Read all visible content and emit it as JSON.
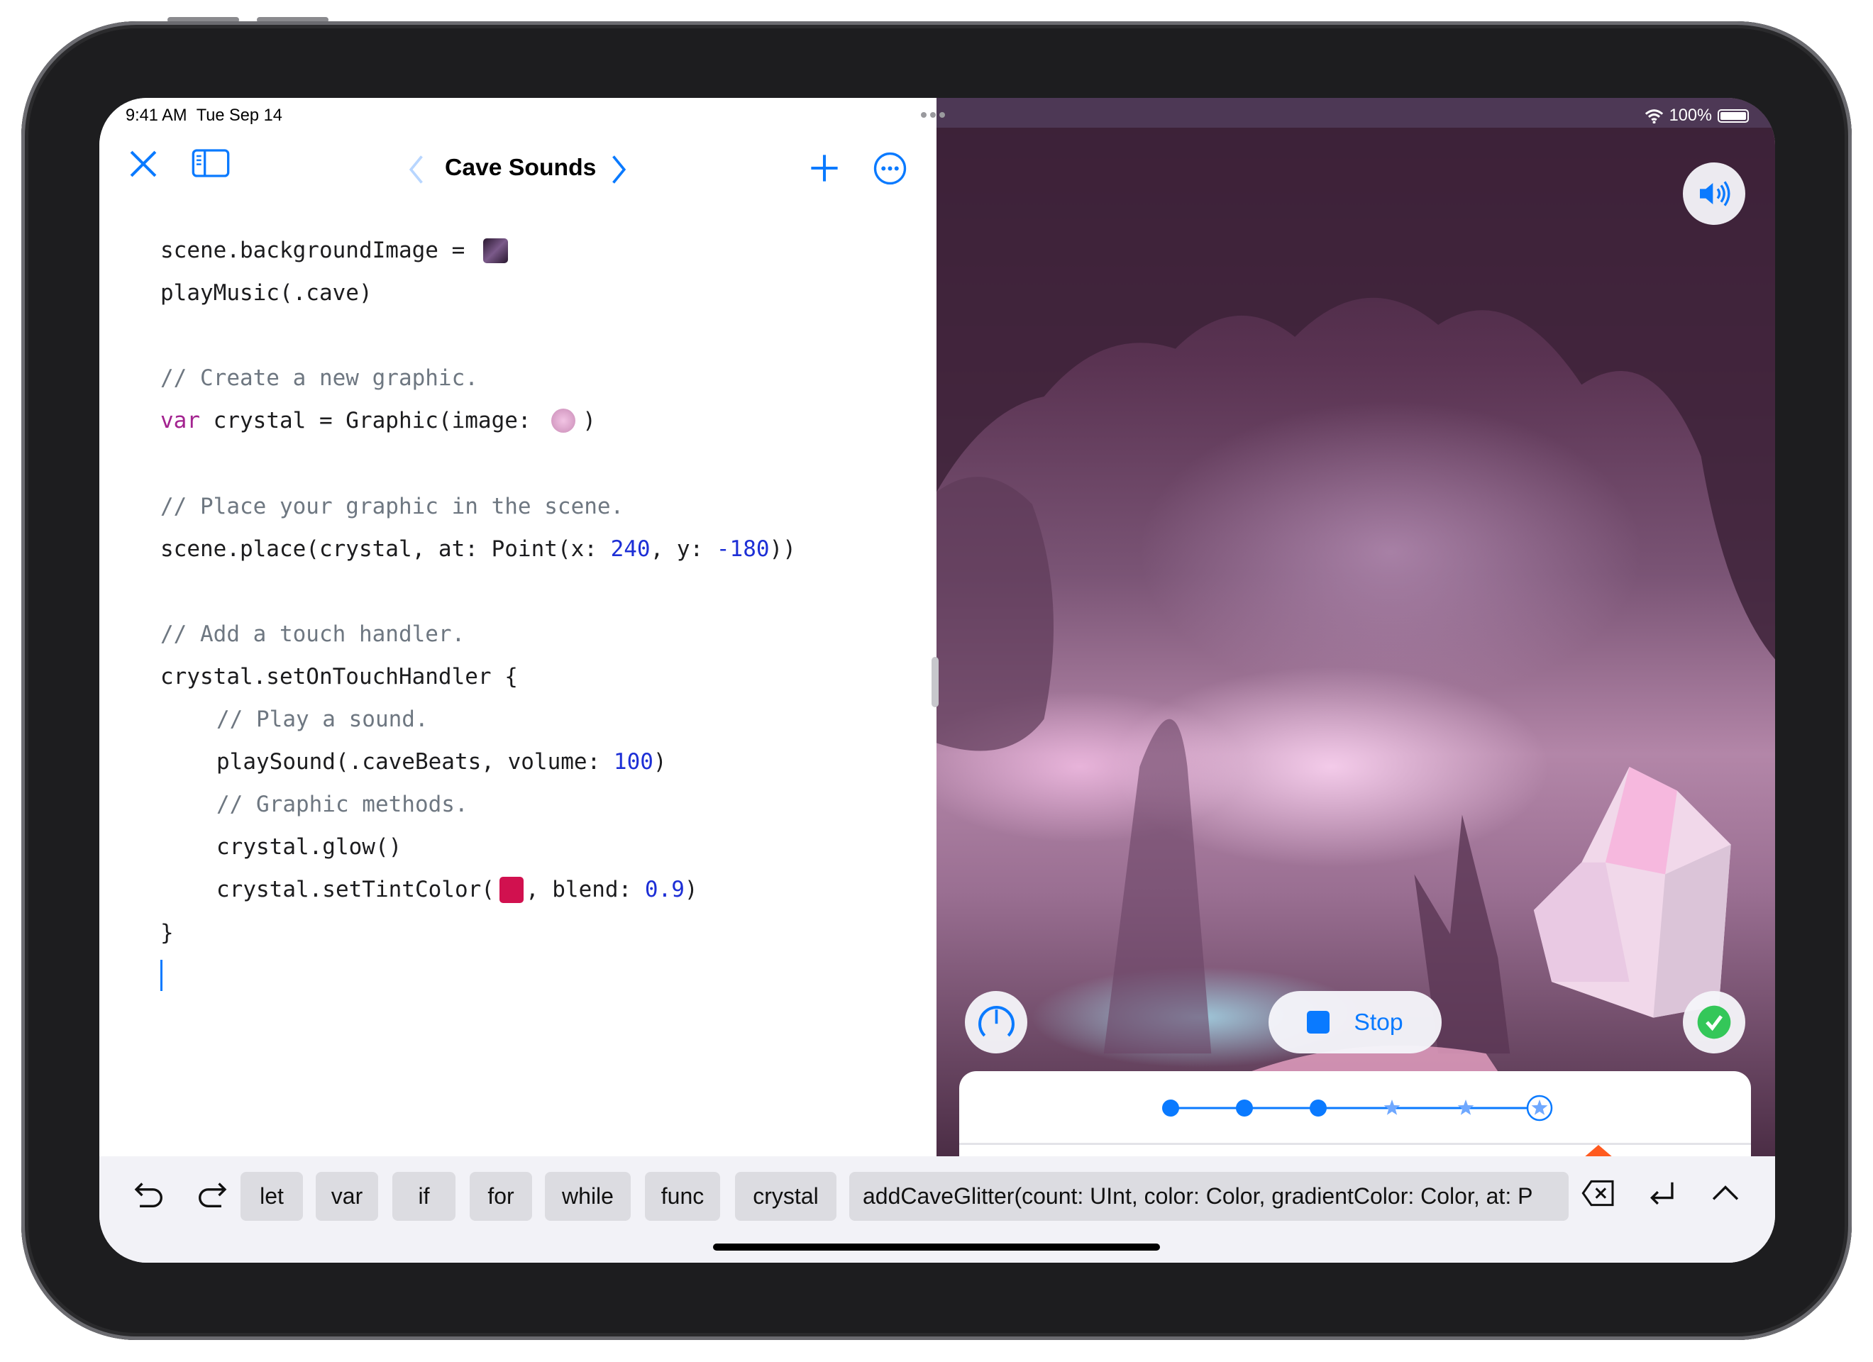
{
  "status_bar": {
    "time": "9:41 AM",
    "date": "Tue Sep 14",
    "battery": "100%"
  },
  "toolbar": {
    "title": "Cave Sounds",
    "close_icon": "close-icon",
    "sidebar_icon": "sidebar-icon",
    "back_icon": "chevron-left-icon",
    "forward_icon": "chevron-right-icon",
    "add_icon": "plus-icon",
    "more_icon": "ellipsis-circle-icon"
  },
  "code": {
    "l1": "scene.backgroundImage = ",
    "l2": "playMusic(.cave)",
    "l3": "// Create a new graphic.",
    "l4_kw": "var",
    "l4a": " crystal = Graphic(image: ",
    "l4b": ")",
    "l5": "// Place your graphic in the scene.",
    "l6a": "scene.place(crystal, at: Point(x: ",
    "l6_x": "240",
    "l6b": ", y: ",
    "l6_y": "-180",
    "l6c": "))",
    "l7": "// Add a touch handler.",
    "l8": "crystal.setOnTouchHandler {",
    "l9": "// Play a sound.",
    "l10a": "playSound(.caveBeats, volume: ",
    "l10_v": "100",
    "l10b": ")",
    "l11": "// Graphic methods.",
    "l12": "crystal.glow()",
    "l13a": "crystal.setTintColor(",
    "l13b": ", blend: ",
    "l13_v": "0.9",
    "l13c": ")",
    "l14": "}",
    "tint_color": "#d1114f"
  },
  "keyboard_bar": {
    "keys": [
      "let",
      "var",
      "if",
      "for",
      "while",
      "func",
      "crystal"
    ],
    "suggestion": "addCaveGlitter(count: UInt, color: Color, gradientColor: Color, at: P"
  },
  "live_view": {
    "stop_label": "Stop",
    "progress": {
      "completed_steps": 3,
      "total_steps": 6
    }
  },
  "colors": {
    "accent": "#0a7aff",
    "success": "#34c759"
  }
}
